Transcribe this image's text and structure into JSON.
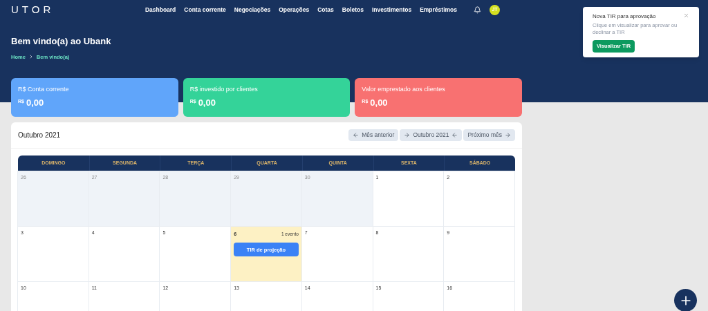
{
  "logo": "UTOR",
  "nav": [
    "Dashboard",
    "Conta corrente",
    "Negociações",
    "Operações",
    "Cotas",
    "Boletos",
    "Investimentos",
    "Empréstimos"
  ],
  "avatar": {
    "initials": "JT",
    "color": "#d4e021"
  },
  "page": {
    "title": "Bem vindo(a) ao Ubank",
    "breadcrumb": [
      "Home",
      "Bem vindo(a)"
    ]
  },
  "stats": [
    {
      "label": "R$ Conta corrente",
      "currency": "R$",
      "value": "0,00",
      "color": "#60a5fa"
    },
    {
      "label": "R$ investido por clientes",
      "currency": "R$",
      "value": "0,00",
      "color": "#34d399"
    },
    {
      "label": "Valor emprestado aos clientes",
      "currency": "R$",
      "value": "0,00",
      "color": "#f87171"
    }
  ],
  "calendar": {
    "title": "Outubro 2021",
    "buttons": [
      {
        "label": "Mês anterior",
        "kind": "prev"
      },
      {
        "label": "Outubro 2021",
        "kind": "current"
      },
      {
        "label": "Próximo mês",
        "kind": "next"
      }
    ],
    "weekdays": [
      "DOMINGO",
      "SEGUNDA",
      "TERÇA",
      "QUARTA",
      "QUINTA",
      "SEXTA",
      "SÁBADO"
    ],
    "weeks": [
      [
        {
          "day": "26",
          "outside": true,
          "today": false
        },
        {
          "day": "27",
          "outside": true,
          "today": false
        },
        {
          "day": "28",
          "outside": true,
          "today": false
        },
        {
          "day": "29",
          "outside": true,
          "today": false
        },
        {
          "day": "30",
          "outside": true,
          "today": false
        },
        {
          "day": "1",
          "outside": false,
          "today": false
        },
        {
          "day": "2",
          "outside": false,
          "today": false
        }
      ],
      [
        {
          "day": "3",
          "outside": false,
          "today": false
        },
        {
          "day": "4",
          "outside": false,
          "today": false
        },
        {
          "day": "5",
          "outside": false,
          "today": false
        },
        {
          "day": "6",
          "outside": false,
          "today": true,
          "count": "1 evento",
          "events": [
            "TIR de projeção"
          ]
        },
        {
          "day": "7",
          "outside": false,
          "today": false
        },
        {
          "day": "8",
          "outside": false,
          "today": false
        },
        {
          "day": "9",
          "outside": false,
          "today": false
        }
      ],
      [
        {
          "day": "10",
          "outside": false,
          "today": false
        },
        {
          "day": "11",
          "outside": false,
          "today": false
        },
        {
          "day": "12",
          "outside": false,
          "today": false
        },
        {
          "day": "13",
          "outside": false,
          "today": false
        },
        {
          "day": "14",
          "outside": false,
          "today": false
        },
        {
          "day": "15",
          "outside": false,
          "today": false
        },
        {
          "day": "16",
          "outside": false,
          "today": false
        }
      ]
    ]
  },
  "toast": {
    "title": "Nova TIR para aprovação",
    "message": "Clique em visualizar para aprovar ou declinar a TIR",
    "action": "Visualizar TIR"
  }
}
